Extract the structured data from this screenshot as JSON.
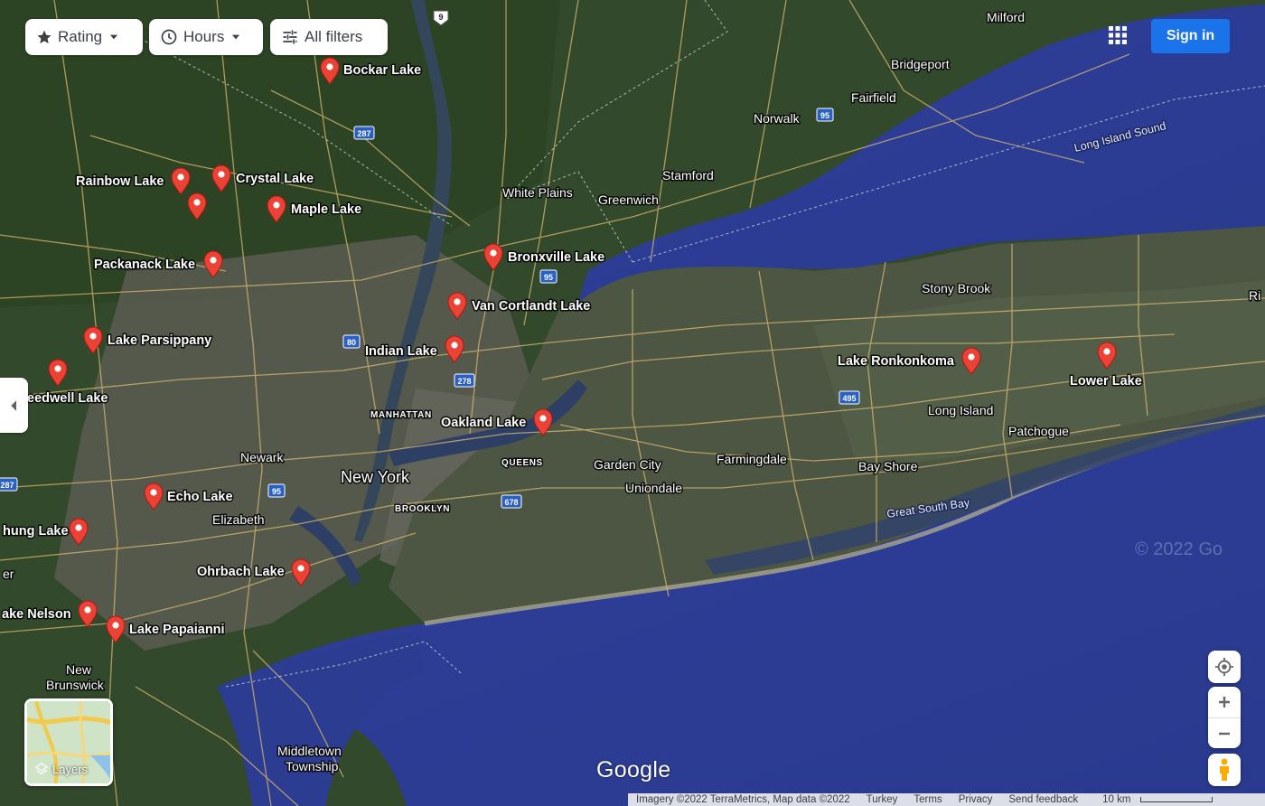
{
  "filters": {
    "rating_label": "Rating",
    "hours_label": "Hours",
    "all_filters_label": "All filters"
  },
  "header": {
    "signin_label": "Sign in"
  },
  "layers": {
    "label": "Layers"
  },
  "logo": "Google",
  "footer": {
    "imagery": "Imagery ©2022 TerraMetrics, Map data ©2022",
    "country": "Turkey",
    "terms": "Terms",
    "privacy": "Privacy",
    "feedback": "Send feedback",
    "scale": "10 km"
  },
  "watermark": "© 2022 Go",
  "map": {
    "lakes": [
      {
        "name": "Bockar Lake"
      },
      {
        "name": "Rainbow Lake"
      },
      {
        "name": "Crystal Lake"
      },
      {
        "name": "Maple Lake"
      },
      {
        "name": "Packanack Lake"
      },
      {
        "name": "Lake Parsippany"
      },
      {
        "name": "eedwell Lake"
      },
      {
        "name": "Echo Lake"
      },
      {
        "name": "hung Lake"
      },
      {
        "name": "Ohrbach Lake"
      },
      {
        "name": "ake Nelson"
      },
      {
        "name": "Lake Papaianni"
      },
      {
        "name": "Bronxville Lake"
      },
      {
        "name": "Van Cortlandt Lake"
      },
      {
        "name": "Indian Lake"
      },
      {
        "name": "Oakland Lake"
      },
      {
        "name": "Lake Ronkonkoma"
      },
      {
        "name": "Lower Lake"
      }
    ],
    "places": [
      "Milford",
      "Bridgeport",
      "Fairfield",
      "Norwalk",
      "Stamford",
      "White Plains",
      "Greenwich",
      "Stony Brook",
      "Long Island",
      "Patchogue",
      "Bay Shore",
      "Farmingdale",
      "Garden City",
      "Uniondale",
      "Newark",
      "Elizabeth",
      "New",
      "Brunswick",
      "Middletown",
      "Township",
      "Ri",
      "er"
    ],
    "city": "New York",
    "boroughs": [
      "MANHATTAN",
      "QUEENS",
      "BROOKLYN"
    ],
    "water": [
      "Long Island Sound",
      "Great South Bay"
    ],
    "highways": [
      "9",
      "287",
      "95",
      "80",
      "278",
      "95",
      "495",
      "678",
      "287",
      "95"
    ]
  }
}
